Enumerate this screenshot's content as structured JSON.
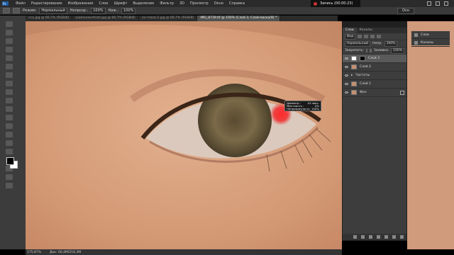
{
  "menubar": {
    "items": [
      "Файл",
      "Редактирование",
      "Изображение",
      "Слои",
      "Шрифт",
      "Выделение",
      "Фильтр",
      "3D",
      "Просмотр",
      "Окно",
      "Справка"
    ],
    "notification": "Запись (00:00:23)"
  },
  "options": {
    "mode_label": "Режим:",
    "mode_value": "Нормальный",
    "opacity_label": "Непрозр.:",
    "opacity_value": "100%",
    "flow_label": "Наж.:",
    "flow_value": "100%",
    "workspace": "Осн"
  },
  "tabs": [
    {
      "label": "ссъ.jpg @ 66,7% (RGB/8)",
      "active": false
    },
    {
      "label": "ssamxxxxrrtsoll.jpg @ 66,7% (RGB/8)",
      "active": false
    },
    {
      "label": "со-глаза-2.jpg @ 66,7% (RGB/8)",
      "active": false
    },
    {
      "label": "IMG_8739.tif @ 100% (Слой 3, Слой-маска/8) *",
      "active": true
    }
  ],
  "brush_tooltip": {
    "diameter_label": "Диаметр :",
    "diameter_value": "43 пикс.",
    "hardness_label": "Жесткость :",
    "hardness_value": "0%",
    "flow_label": "Непрозрачность :",
    "flow_value": "100%"
  },
  "layers_panel": {
    "tabs": [
      "Слои",
      "Каналы"
    ],
    "kind_label": "Вид",
    "blend_mode": "Нормальный",
    "opacity_label": "Непр:",
    "opacity_value": "100%",
    "lock_label": "Закрепить:",
    "fill_label": "Заливка:",
    "fill_value": "100%",
    "layers": [
      {
        "name": "Слой 3",
        "selected": true,
        "thumb": "mask"
      },
      {
        "name": "Слой 2",
        "selected": false,
        "thumb": "photo"
      },
      {
        "name": "Частоты",
        "selected": false,
        "thumb": "folder"
      },
      {
        "name": "Слой 1",
        "selected": false,
        "thumb": "photo"
      },
      {
        "name": "Фон",
        "selected": false,
        "thumb": "photo"
      }
    ]
  },
  "side_panels": [
    "Слои",
    "Каналы"
  ],
  "status": {
    "zoom": "175,87%",
    "doc": "Док: 60,4М/216,3М"
  }
}
